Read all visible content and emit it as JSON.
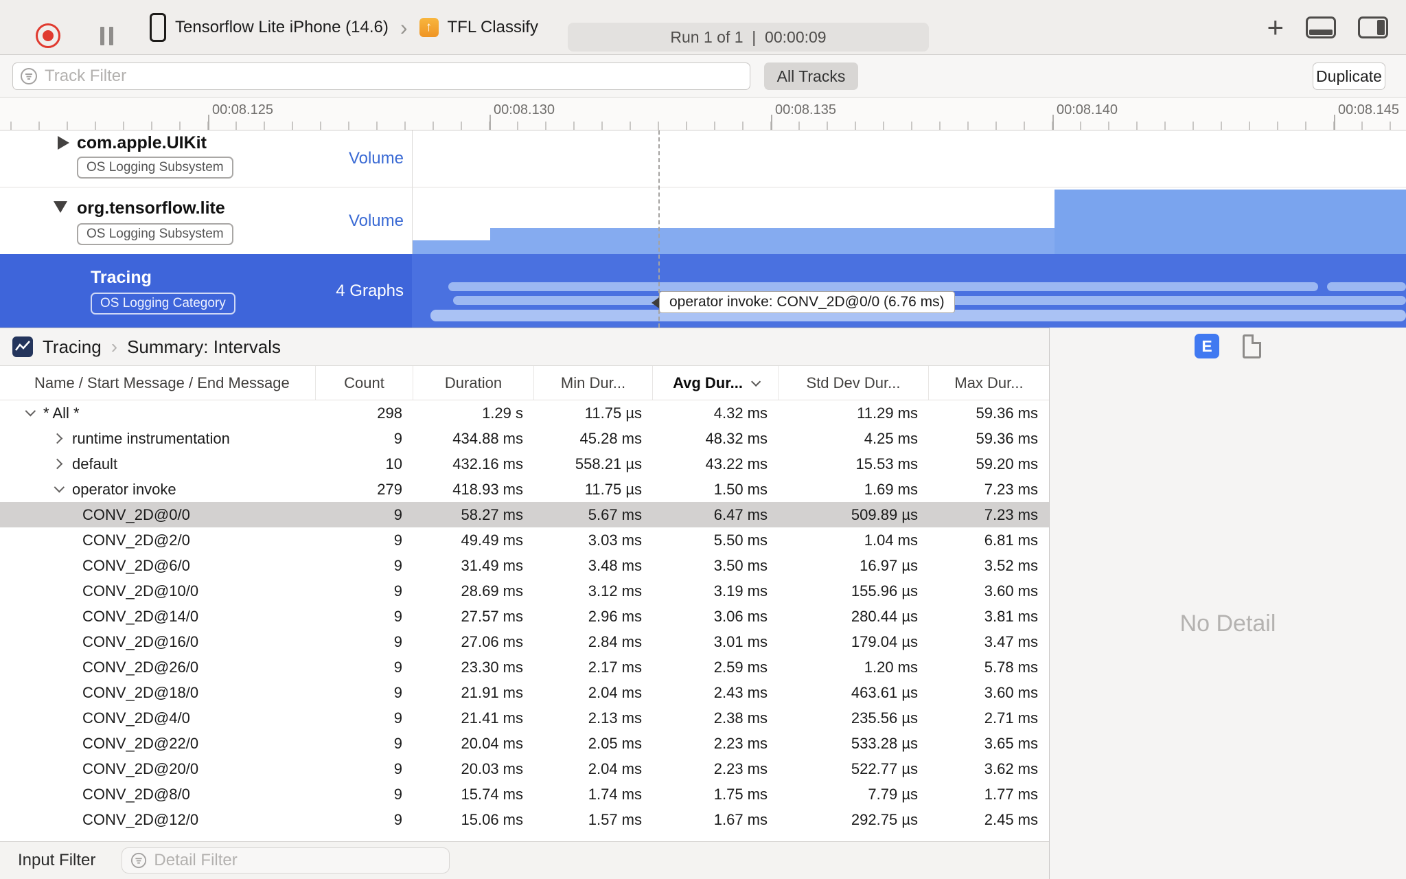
{
  "toolbar": {
    "device_name": "Tensorflow Lite iPhone (14.6)",
    "target_name": "TFL Classify",
    "run_status": "Run 1 of 1  |  00:00:09"
  },
  "filter_bar": {
    "track_filter_placeholder": "Track Filter",
    "all_tracks_label": "All Tracks",
    "duplicate_label": "Duplicate"
  },
  "timeline": {
    "tick_labels": [
      "00:08.125",
      "00:08.130",
      "00:08.135",
      "00:08.140",
      "00:08.145"
    ]
  },
  "tracks": [
    {
      "name": "com.apple.UIKit",
      "badge": "OS Logging Subsystem",
      "right_label": "Volume",
      "disclosure": "collapsed"
    },
    {
      "name": "org.tensorflow.lite",
      "badge": "OS Logging Subsystem",
      "right_label": "Volume",
      "disclosure": "expanded"
    },
    {
      "name": "Tracing",
      "badge": "OS Logging Category",
      "right_label": "4 Graphs",
      "selected": true
    }
  ],
  "track_tooltip": "operator invoke: CONV_2D@0/0 (6.76 ms)",
  "detail_pane": {
    "breadcrumb_root": "Tracing",
    "breadcrumb_page": "Summary: Intervals",
    "view_button_label": "E",
    "no_detail_text": "No Detail",
    "input_filter_label": "Input Filter",
    "detail_filter_placeholder": "Detail Filter"
  },
  "table": {
    "columns": [
      "Name / Start Message / End Message",
      "Count",
      "Duration",
      "Min Dur...",
      "Avg Dur...",
      "Std Dev Dur...",
      "Max Dur..."
    ],
    "sort_column": "Avg Dur...",
    "rows": [
      {
        "indent": 0,
        "expander": "down",
        "name": "* All *",
        "count": "298",
        "duration": "1.29 s",
        "min": "11.75 µs",
        "avg": "4.32 ms",
        "std_dev": "11.29 ms",
        "max": "59.36 ms",
        "selected": false
      },
      {
        "indent": 1,
        "expander": "right",
        "name": "runtime instrumentation",
        "count": "9",
        "duration": "434.88 ms",
        "min": "45.28 ms",
        "avg": "48.32 ms",
        "std_dev": "4.25 ms",
        "max": "59.36 ms",
        "selected": false
      },
      {
        "indent": 1,
        "expander": "right",
        "name": "default",
        "count": "10",
        "duration": "432.16 ms",
        "min": "558.21 µs",
        "avg": "43.22 ms",
        "std_dev": "15.53 ms",
        "max": "59.20 ms",
        "selected": false
      },
      {
        "indent": 1,
        "expander": "down",
        "name": "operator invoke",
        "count": "279",
        "duration": "418.93 ms",
        "min": "11.75 µs",
        "avg": "1.50 ms",
        "std_dev": "1.69 ms",
        "max": "7.23 ms",
        "selected": false
      },
      {
        "indent": 2,
        "expander": "none",
        "name": "CONV_2D@0/0",
        "count": "9",
        "duration": "58.27 ms",
        "min": "5.67 ms",
        "avg": "6.47 ms",
        "std_dev": "509.89 µs",
        "max": "7.23 ms",
        "selected": true
      },
      {
        "indent": 2,
        "expander": "none",
        "name": "CONV_2D@2/0",
        "count": "9",
        "duration": "49.49 ms",
        "min": "3.03 ms",
        "avg": "5.50 ms",
        "std_dev": "1.04 ms",
        "max": "6.81 ms",
        "selected": false
      },
      {
        "indent": 2,
        "expander": "none",
        "name": "CONV_2D@6/0",
        "count": "9",
        "duration": "31.49 ms",
        "min": "3.48 ms",
        "avg": "3.50 ms",
        "std_dev": "16.97 µs",
        "max": "3.52 ms",
        "selected": false
      },
      {
        "indent": 2,
        "expander": "none",
        "name": "CONV_2D@10/0",
        "count": "9",
        "duration": "28.69 ms",
        "min": "3.12 ms",
        "avg": "3.19 ms",
        "std_dev": "155.96 µs",
        "max": "3.60 ms",
        "selected": false
      },
      {
        "indent": 2,
        "expander": "none",
        "name": "CONV_2D@14/0",
        "count": "9",
        "duration": "27.57 ms",
        "min": "2.96 ms",
        "avg": "3.06 ms",
        "std_dev": "280.44 µs",
        "max": "3.81 ms",
        "selected": false
      },
      {
        "indent": 2,
        "expander": "none",
        "name": "CONV_2D@16/0",
        "count": "9",
        "duration": "27.06 ms",
        "min": "2.84 ms",
        "avg": "3.01 ms",
        "std_dev": "179.04 µs",
        "max": "3.47 ms",
        "selected": false
      },
      {
        "indent": 2,
        "expander": "none",
        "name": "CONV_2D@26/0",
        "count": "9",
        "duration": "23.30 ms",
        "min": "2.17 ms",
        "avg": "2.59 ms",
        "std_dev": "1.20 ms",
        "max": "5.78 ms",
        "selected": false
      },
      {
        "indent": 2,
        "expander": "none",
        "name": "CONV_2D@18/0",
        "count": "9",
        "duration": "21.91 ms",
        "min": "2.04 ms",
        "avg": "2.43 ms",
        "std_dev": "463.61 µs",
        "max": "3.60 ms",
        "selected": false
      },
      {
        "indent": 2,
        "expander": "none",
        "name": "CONV_2D@4/0",
        "count": "9",
        "duration": "21.41 ms",
        "min": "2.13 ms",
        "avg": "2.38 ms",
        "std_dev": "235.56 µs",
        "max": "2.71 ms",
        "selected": false
      },
      {
        "indent": 2,
        "expander": "none",
        "name": "CONV_2D@22/0",
        "count": "9",
        "duration": "20.04 ms",
        "min": "2.05 ms",
        "avg": "2.23 ms",
        "std_dev": "533.28 µs",
        "max": "3.65 ms",
        "selected": false
      },
      {
        "indent": 2,
        "expander": "none",
        "name": "CONV_2D@20/0",
        "count": "9",
        "duration": "20.03 ms",
        "min": "2.04 ms",
        "avg": "2.23 ms",
        "std_dev": "522.77 µs",
        "max": "3.62 ms",
        "selected": false
      },
      {
        "indent": 2,
        "expander": "none",
        "name": "CONV_2D@8/0",
        "count": "9",
        "duration": "15.74 ms",
        "min": "1.74 ms",
        "avg": "1.75 ms",
        "std_dev": "7.79 µs",
        "max": "1.77 ms",
        "selected": false
      },
      {
        "indent": 2,
        "expander": "none",
        "name": "CONV_2D@12/0",
        "count": "9",
        "duration": "15.06 ms",
        "min": "1.57 ms",
        "avg": "1.67 ms",
        "std_dev": "292.75 µs",
        "max": "2.45 ms",
        "selected": false
      }
    ]
  },
  "colors": {
    "selection_blue": "#3e65da",
    "selection_content": "#4a71e0",
    "chart_blue": "#85abf0",
    "accent_blue": "#3a6ad4"
  }
}
